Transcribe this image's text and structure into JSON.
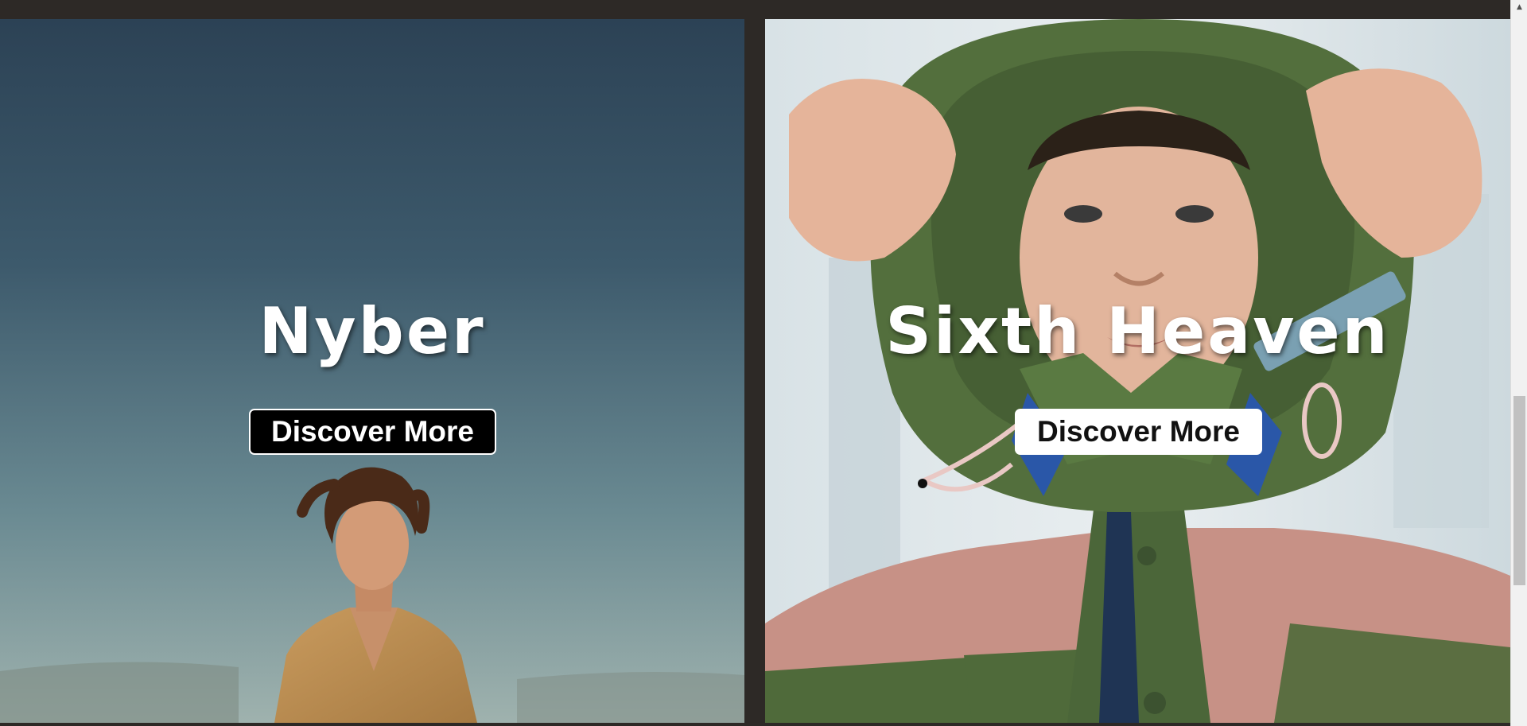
{
  "panels": [
    {
      "title": "Nyber",
      "button_label": "Discover More"
    },
    {
      "title": "Sixth Heaven",
      "button_label": "Discover More"
    }
  ],
  "icons": {
    "scroll_up": "▲"
  },
  "colors": {
    "page_background": "#2d2926",
    "left_button_bg": "#000000",
    "right_button_bg": "#ffffff"
  }
}
